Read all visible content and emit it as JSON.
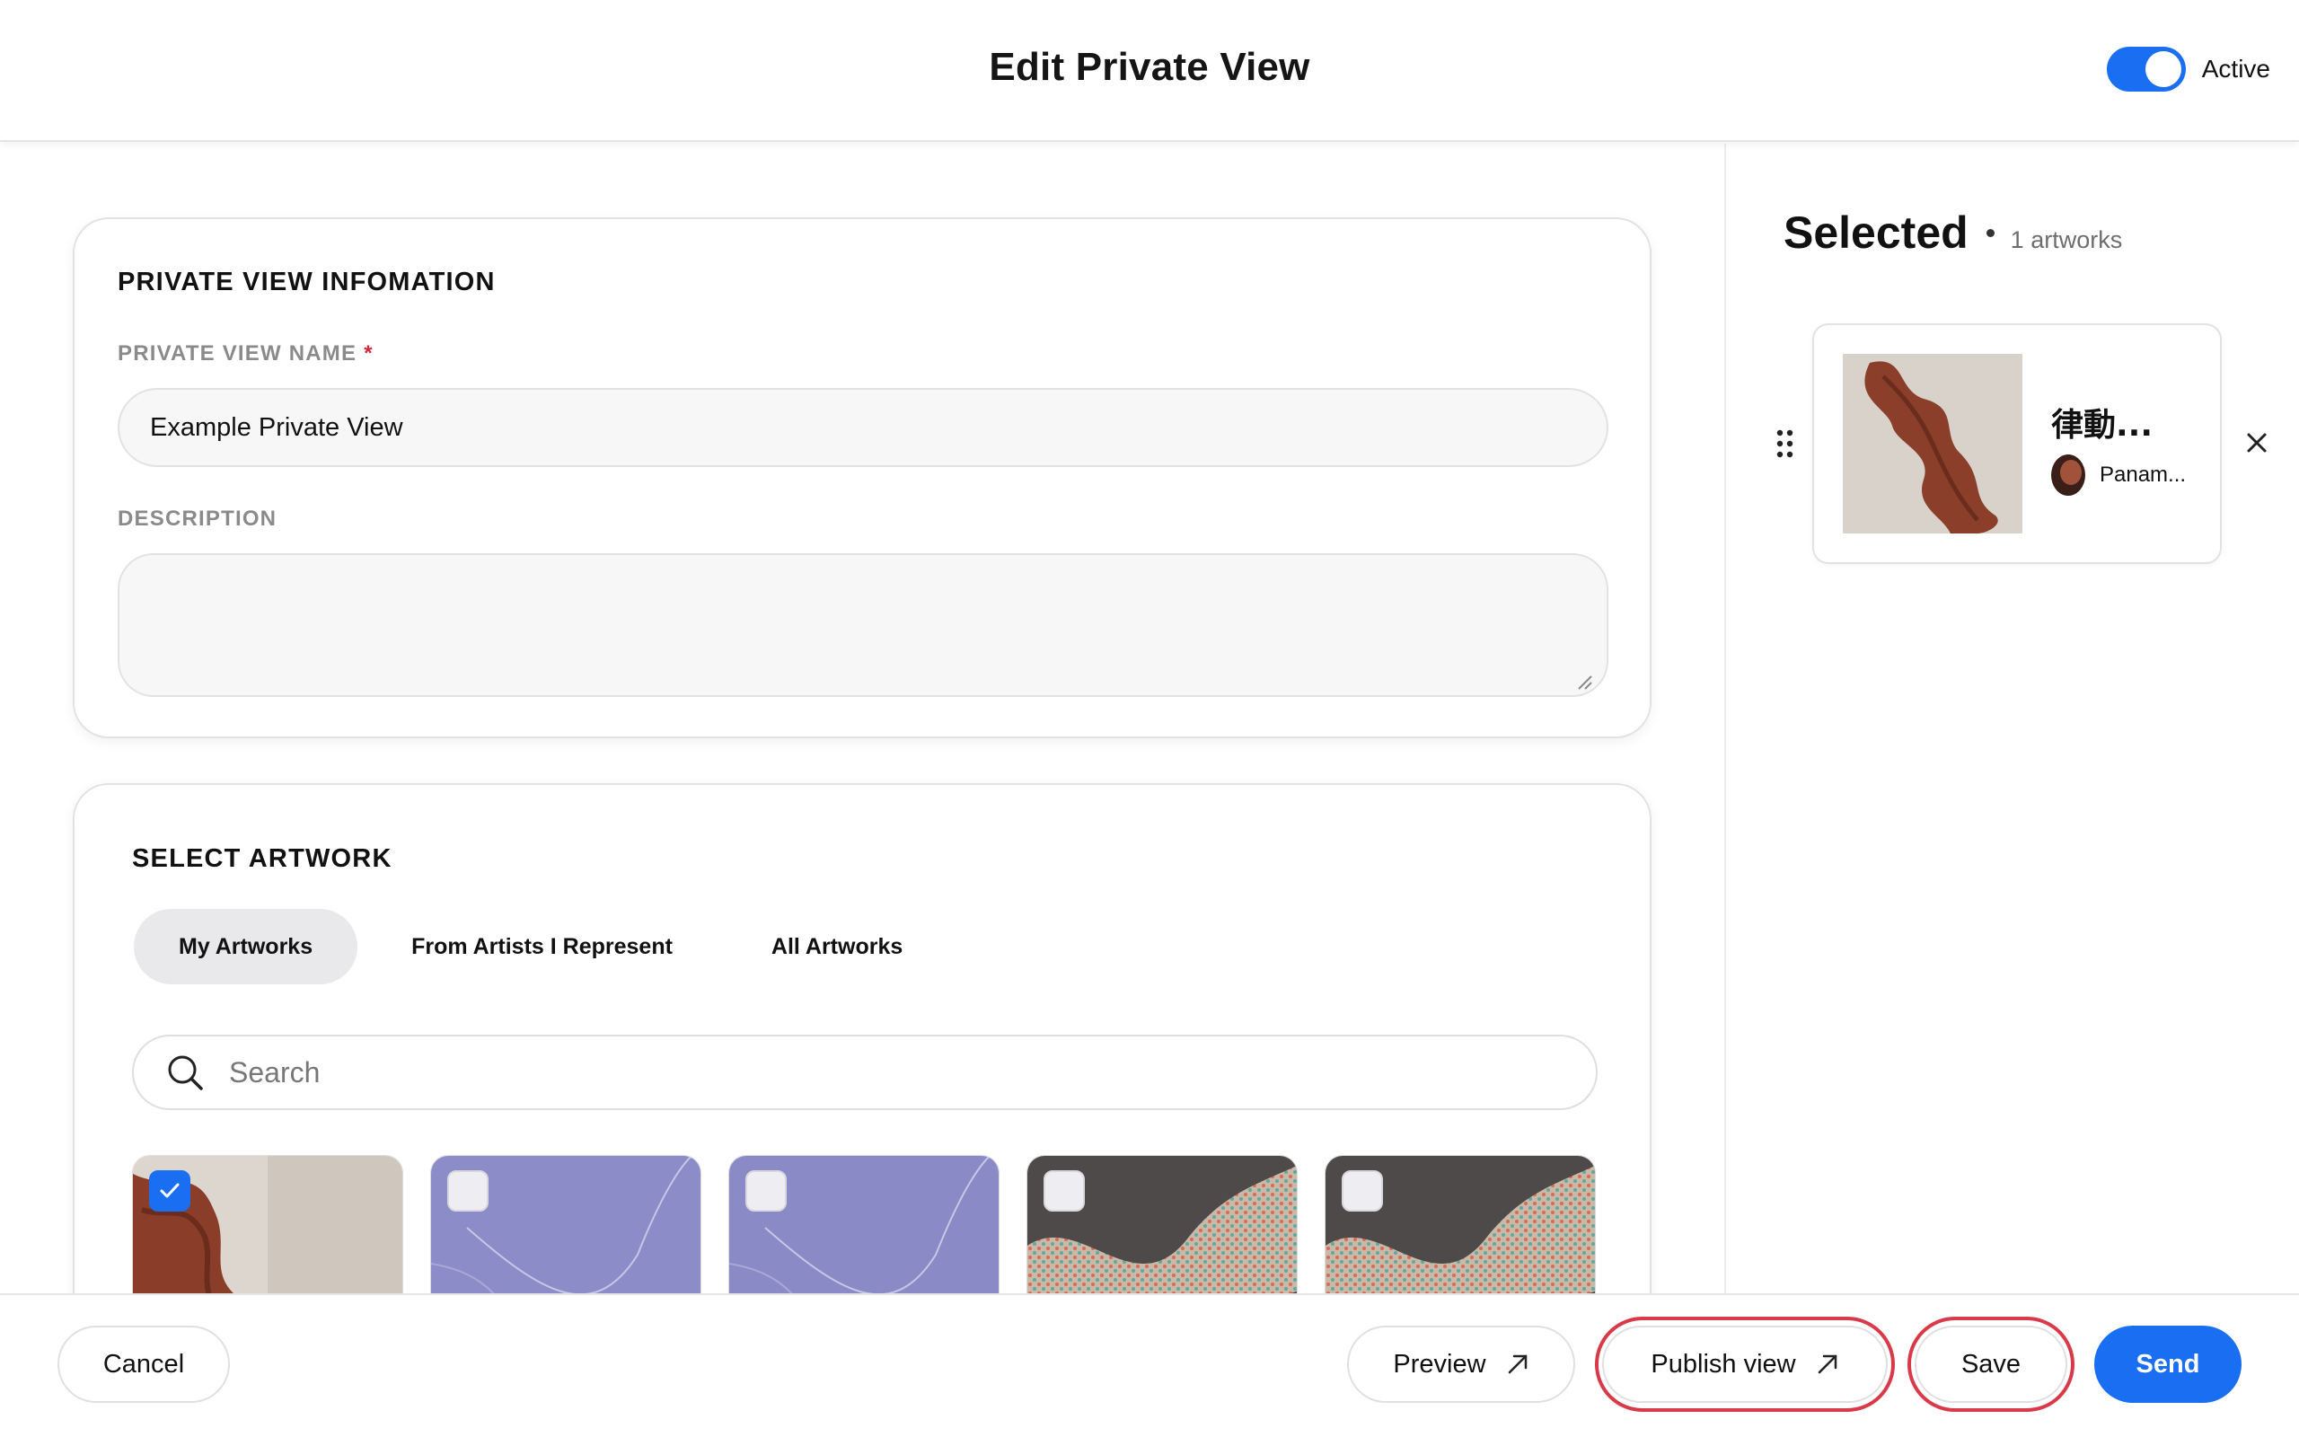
{
  "header": {
    "title": "Edit Private View",
    "active_label": "Active",
    "active_on": true
  },
  "info": {
    "section_title": "PRIVATE VIEW INFOMATION",
    "name_label": "PRIVATE VIEW NAME",
    "required_mark": "*",
    "name_value": "Example Private View",
    "description_label": "DESCRIPTION",
    "description_value": ""
  },
  "artwork": {
    "section_title": "SELECT ARTWORK",
    "tabs": [
      {
        "label": "My Artworks",
        "active": true
      },
      {
        "label": "From Artists I Represent",
        "active": false
      },
      {
        "label": "All Artworks",
        "active": false
      }
    ],
    "search_placeholder": "Search",
    "thumbnails": [
      {
        "checked": true
      },
      {
        "checked": false
      },
      {
        "checked": false
      },
      {
        "checked": false
      },
      {
        "checked": false
      }
    ]
  },
  "selected": {
    "title": "Selected",
    "count_label": "1 artworks",
    "items": [
      {
        "title": "律動...",
        "artist": "Panam..."
      }
    ]
  },
  "footer": {
    "cancel": "Cancel",
    "preview": "Preview",
    "publish": "Publish view",
    "save": "Save",
    "send": "Send"
  },
  "colors": {
    "accent": "#1a6ef2",
    "highlight_ring": "#d93a4a",
    "required": "#d7263d"
  }
}
